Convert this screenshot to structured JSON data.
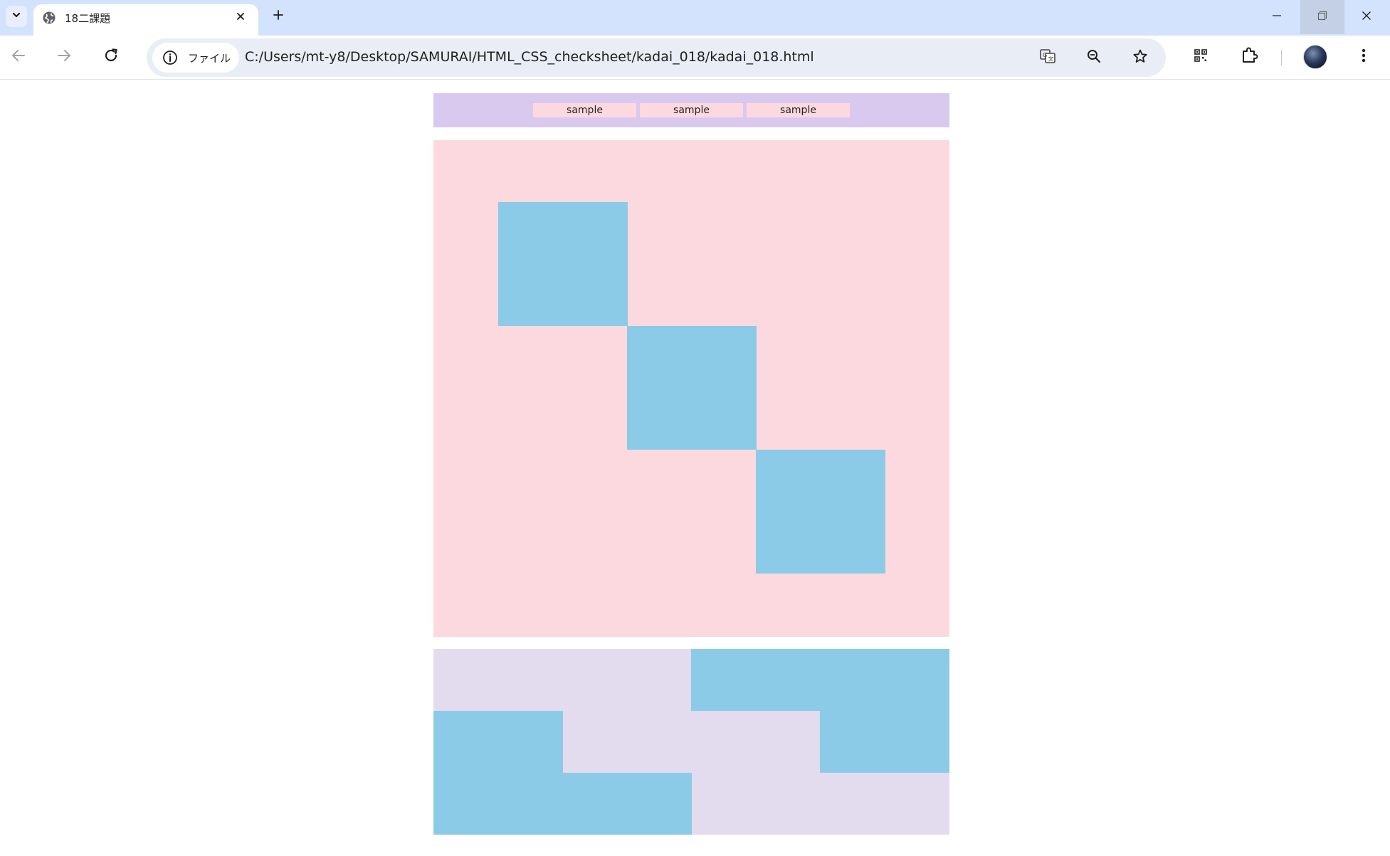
{
  "browser": {
    "tab": {
      "title": "18二課題",
      "favicon": "globe-icon"
    },
    "site_info": {
      "label": "ファイル",
      "icon": "info-icon"
    },
    "url": "C:/Users/mt-y8/Desktop/SAMURAI/HTML_CSS_checksheet/kadai_018/kadai_018.html",
    "icons": {
      "tab_search": "chevron-down-icon",
      "tab_close": "close-icon",
      "new_tab": "plus-icon",
      "minimize": "minimize-icon",
      "restore": "restore-icon",
      "close_window": "close-icon",
      "back": "arrow-left-icon",
      "forward": "arrow-right-icon",
      "reload": "reload-icon",
      "translate": "translate-icon",
      "zoom": "zoom-icon",
      "bookmark": "star-icon",
      "qr": "qr-code-icon",
      "extensions": "puzzle-icon",
      "menu": "kebab-menu-icon"
    },
    "colors": {
      "tabstrip": "#d3e3fd",
      "omnibox": "#e9eef6"
    }
  },
  "page": {
    "nav": {
      "items": [
        "sample",
        "sample",
        "sample"
      ]
    },
    "colors": {
      "header_bg": "#dac9ef",
      "nav_item_bg": "#fcd9df",
      "pink_section_bg": "#fcd9df",
      "blue_square": "#8bcbe7",
      "grid_section_bg": "#e3dbee"
    }
  }
}
